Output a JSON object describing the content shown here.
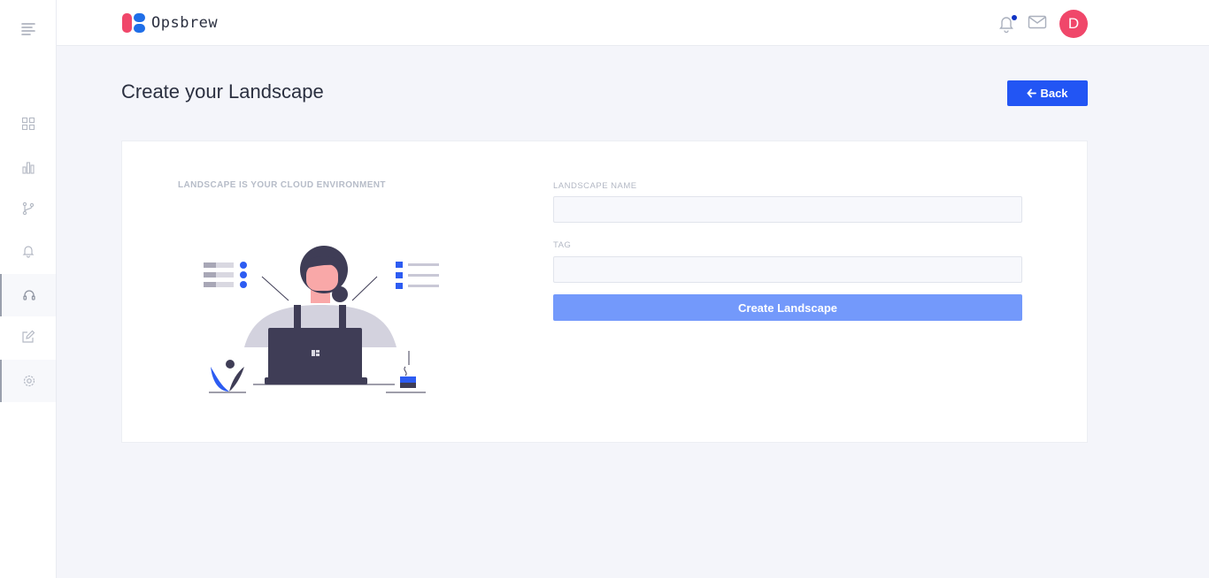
{
  "app": {
    "name": "Opsbrew"
  },
  "sidebar": {
    "items": [
      {
        "icon": "dashboard-grid-icon"
      },
      {
        "icon": "analytics-icon"
      },
      {
        "icon": "branch-icon"
      },
      {
        "icon": "bell-icon"
      },
      {
        "icon": "headset-icon"
      },
      {
        "icon": "edit-icon"
      },
      {
        "icon": "settings-icon"
      }
    ]
  },
  "header": {
    "avatar_initial": "D",
    "notification_dot_color": "#1033c4"
  },
  "page": {
    "title": "Create your Landscape",
    "back_label": "Back"
  },
  "form": {
    "info_heading": "LANDSCAPE IS YOUR CLOUD ENVIRONMENT",
    "name_label": "LANDSCAPE NAME",
    "name_value": "",
    "tag_label": "TAG",
    "tag_value": "",
    "submit_label": "Create Landscape"
  },
  "colors": {
    "accent": "#2255f4",
    "submit_disabled": "#7399fb",
    "avatar": "#f0476a",
    "brand_red": "#f0476a",
    "brand_blue": "#1f6ee8"
  }
}
